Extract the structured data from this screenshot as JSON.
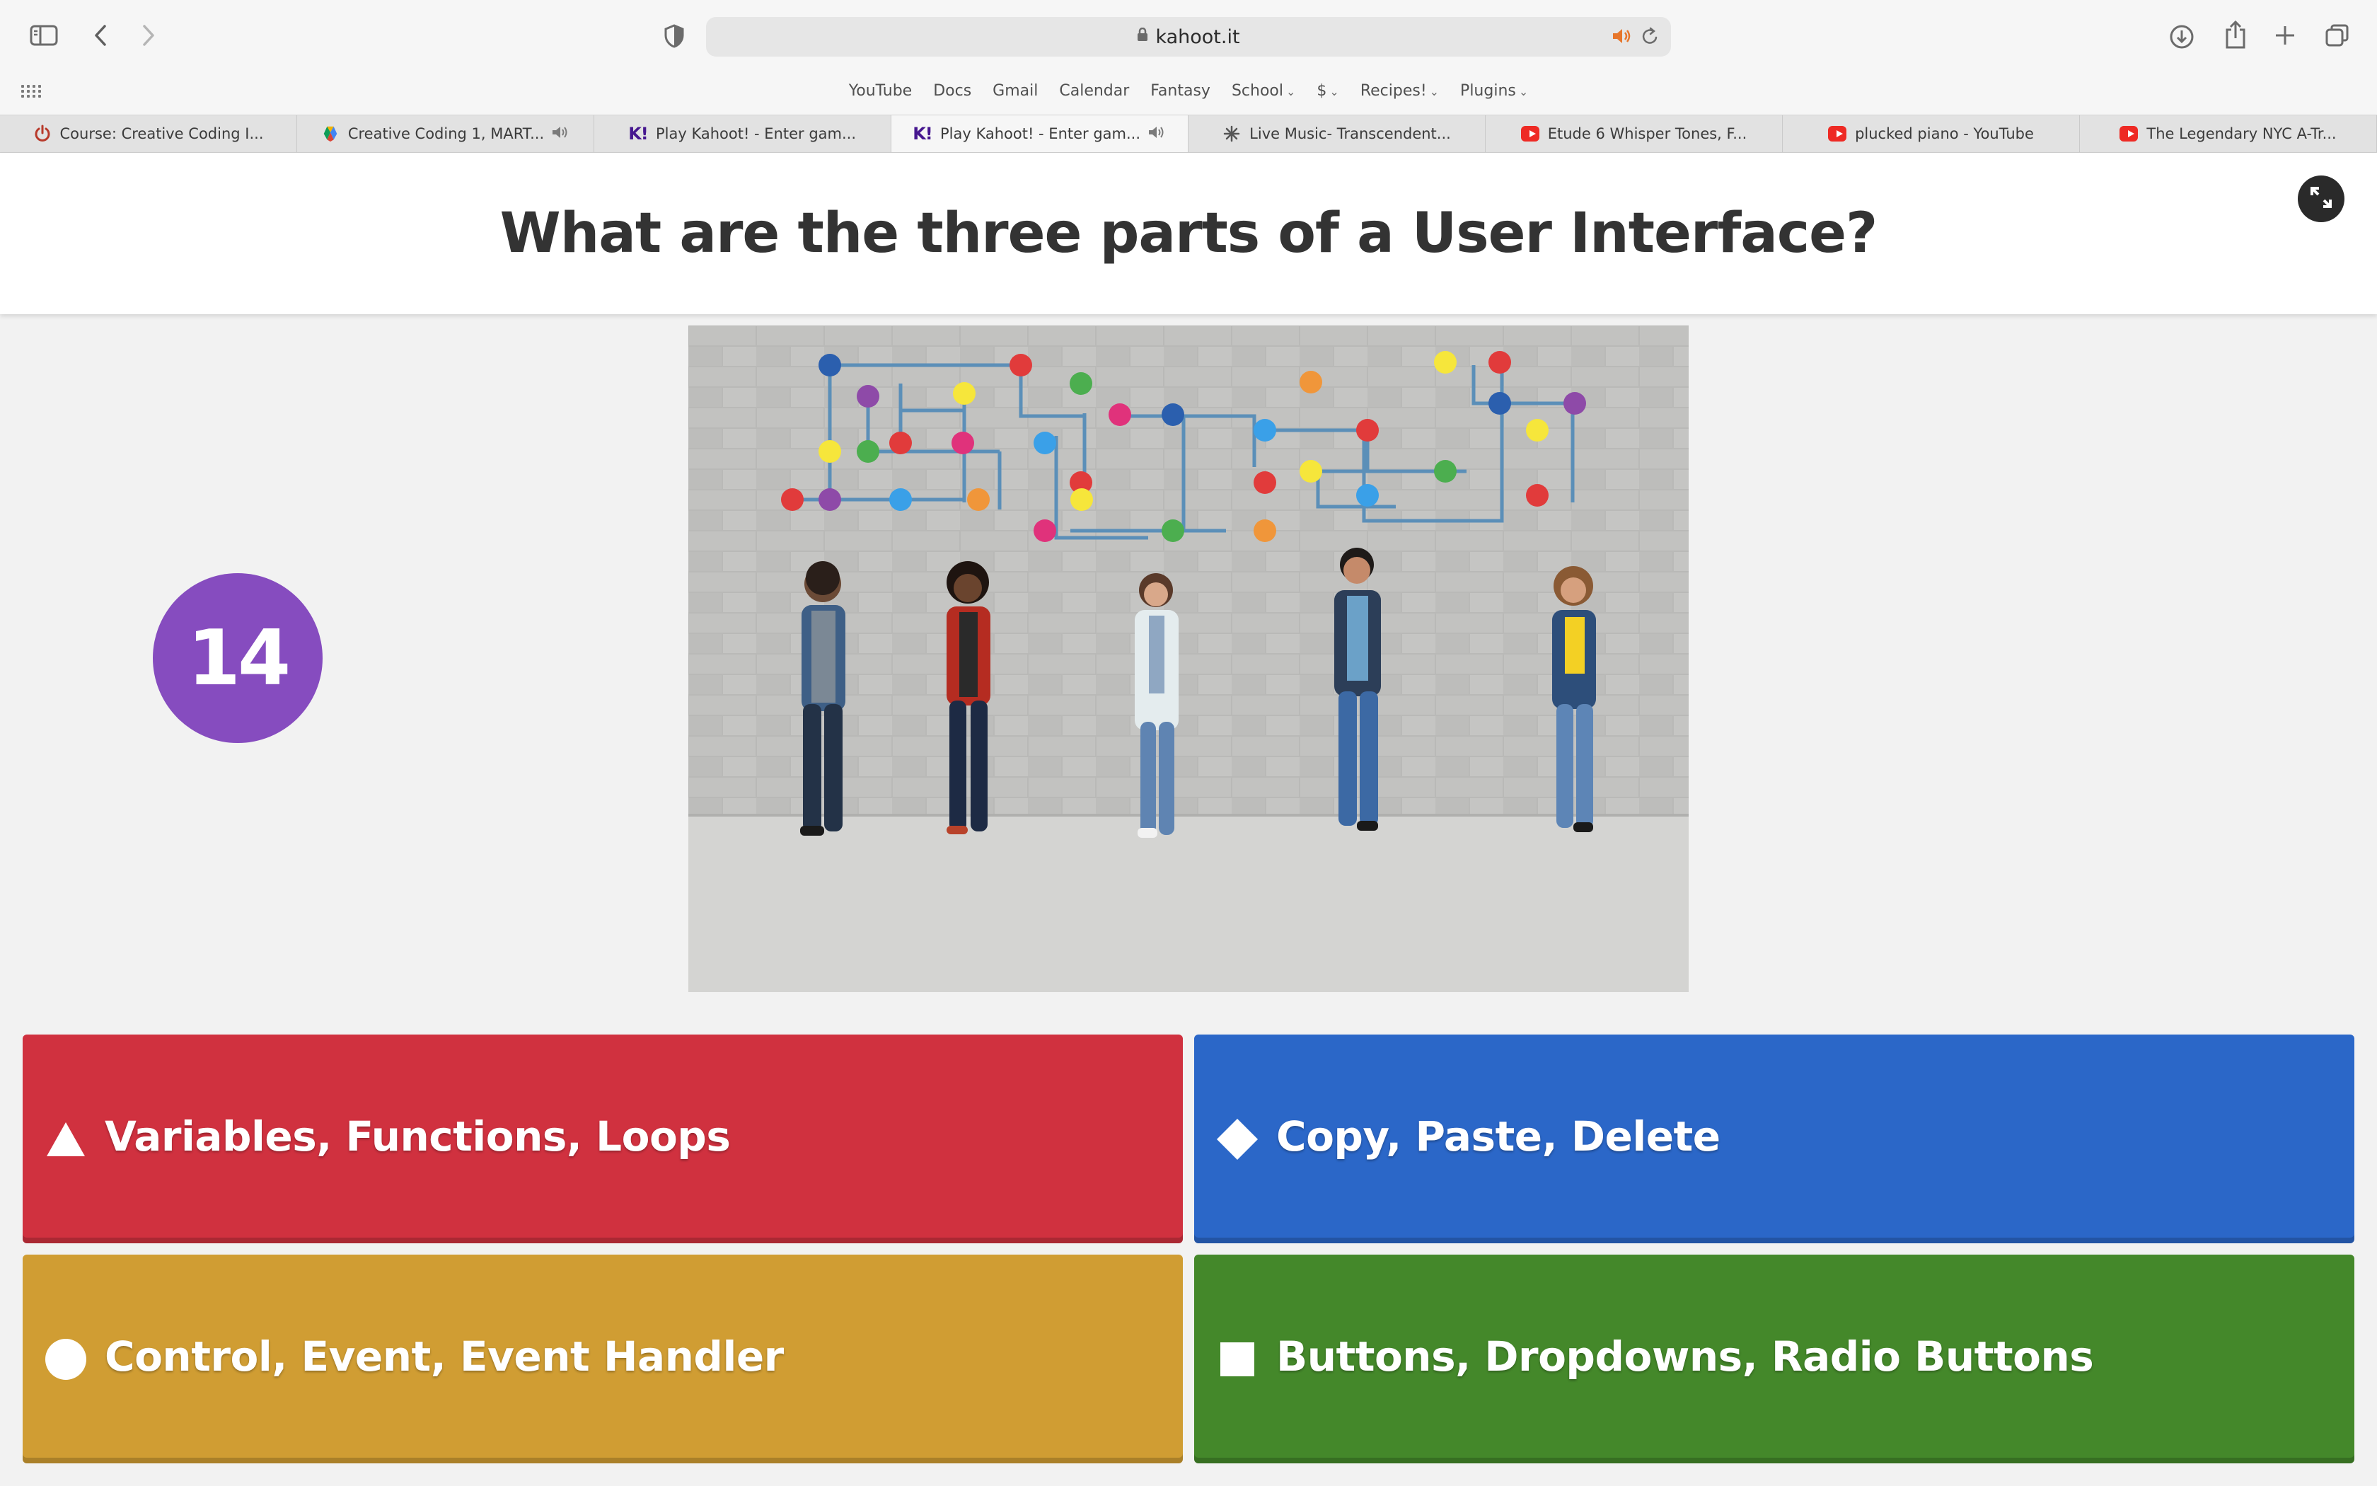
{
  "browser": {
    "address": "kahoot.it",
    "favorites": [
      {
        "label": "YouTube"
      },
      {
        "label": "Docs"
      },
      {
        "label": "Gmail"
      },
      {
        "label": "Calendar"
      },
      {
        "label": "Fantasy"
      },
      {
        "label": "School",
        "menu": true
      },
      {
        "label": "$",
        "menu": true
      },
      {
        "label": "Recipes!",
        "menu": true
      },
      {
        "label": "Plugins",
        "menu": true
      }
    ],
    "tabs": [
      {
        "title": "Course: Creative Coding I...",
        "icon": "power-icon",
        "audio": false,
        "active": false
      },
      {
        "title": "Creative Coding 1, MART...",
        "icon": "drive-icon",
        "audio": true,
        "active": false
      },
      {
        "title": "Play Kahoot! - Enter gam...",
        "icon": "kahoot-icon",
        "audio": false,
        "active": false
      },
      {
        "title": "Play Kahoot! - Enter gam...",
        "icon": "kahoot-icon",
        "audio": true,
        "active": true
      },
      {
        "title": "Live Music- Transcendent...",
        "icon": "spark-icon",
        "audio": false,
        "active": false
      },
      {
        "title": "Etude 6 Whisper Tones, F...",
        "icon": "youtube-icon",
        "audio": false,
        "active": false
      },
      {
        "title": "plucked piano - YouTube",
        "icon": "youtube-icon",
        "audio": false,
        "active": false
      },
      {
        "title": "The Legendary NYC A-Tr...",
        "icon": "youtube-icon",
        "audio": false,
        "active": false
      }
    ],
    "kahoot_logo_text": "K!"
  },
  "question": {
    "title": "What are the three parts of a User Interface?",
    "timer": "14",
    "image_icon": "people-with-phones-network-photo"
  },
  "answers": [
    {
      "label": "Variables, Functions, Loops",
      "shape": "triangle-icon",
      "color": "#d0313f"
    },
    {
      "label": "Copy, Paste, Delete",
      "shape": "diamond-icon",
      "color": "#2b67c8"
    },
    {
      "label": "Control, Event, Event Handler",
      "shape": "circle-icon",
      "color": "#d09d33"
    },
    {
      "label": "Buttons, Dropdowns, Radio Buttons",
      "shape": "square-icon",
      "color": "#44882a"
    }
  ],
  "colors": {
    "timer_bg": "#864cbf",
    "question_text": "#333333",
    "page_bg": "#f2f2f2"
  }
}
